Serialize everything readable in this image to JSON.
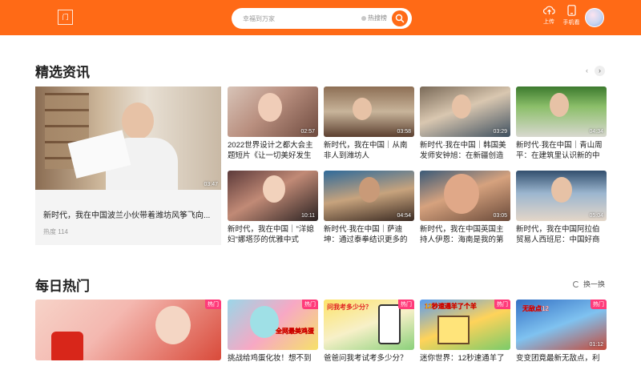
{
  "header": {
    "logo_text": "门",
    "search_placeholder": "幸福到万家",
    "hot_search_label": "热搜榜",
    "upload_label": "上传",
    "mobile_label": "手机看",
    "colors": {
      "brand": "#ff6a16",
      "hot_tag": "#ff3b7a"
    }
  },
  "featured": {
    "title": "精选资讯",
    "main": {
      "title": "新时代，我在中国波兰小伙带着潍坊风筝飞向...",
      "heat": "热度 114",
      "duration": "03:47"
    },
    "cards": [
      {
        "title": "2022世界设计之都大会主题短片《让一切美好发生",
        "duration": "02:57"
      },
      {
        "title": "新时代，我在中国｜从南非人到潍坊人",
        "duration": "03:58"
      },
      {
        "title": "新时代·我在中国｜韩国美发师安钟旭：在新疆创造",
        "duration": "03:29"
      },
      {
        "title": "新时代·我在中国｜青山周平：在建筑里认识新的中",
        "duration": "04:34"
      },
      {
        "title": "新时代，我在中国｜\"洋媳妇\"娜塔莎的优雅中式",
        "duration": "10:11"
      },
      {
        "title": "新时代·我在中国｜萨迪坤：通过泰拳结识更多的中",
        "duration": "04:54"
      },
      {
        "title": "新时代，我在中国英国主持人伊恩：海南是我的第",
        "duration": "03:05"
      },
      {
        "title": "新时代，我在中国阿拉伯贸易人西班尼：中国好商",
        "duration": "05:04"
      }
    ]
  },
  "daily_hot": {
    "title": "每日热门",
    "refresh_label": "换一换",
    "tag_label": "热门",
    "cards": [
      {
        "title": "",
        "caption": ""
      },
      {
        "title": "挑战给鸡蛋化妆！想不到",
        "caption": "全网最美鸡蛋"
      },
      {
        "title": "爸爸问我考试考多少分？",
        "caption": "问我考多少分？"
      },
      {
        "title": "迷你世界：12秒速通羊了",
        "caption": "12秒速通羊了个羊"
      },
      {
        "title": "变变团竟最新无敌点，利",
        "caption": "无敌点12",
        "duration": "01:12"
      }
    ]
  }
}
